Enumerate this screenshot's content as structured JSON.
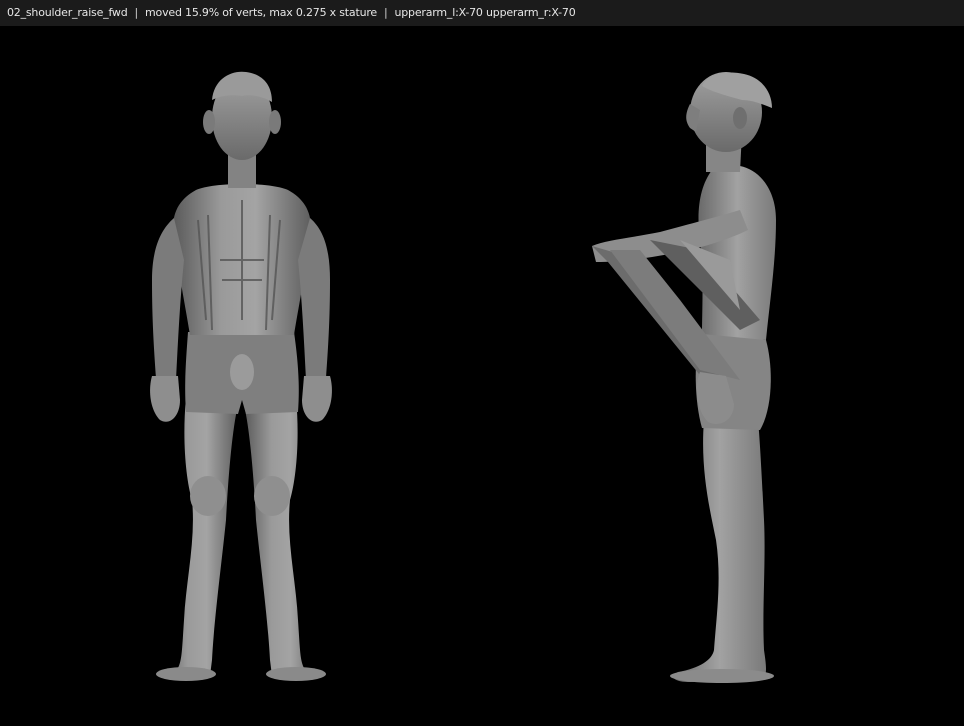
{
  "header": {
    "pose_name": "02_shoulder_raise_fwd",
    "stats": "moved 15.9% of verts, max 0.275 x stature",
    "bones": "upperarm_l:X-70 upperarm_r:X-70",
    "separator": "|"
  },
  "views": [
    {
      "name": "front-view"
    },
    {
      "name": "side-view"
    }
  ],
  "colors": {
    "background": "#000000",
    "header_bg": "#1b1b1b",
    "skin": "#8c8c8c"
  }
}
